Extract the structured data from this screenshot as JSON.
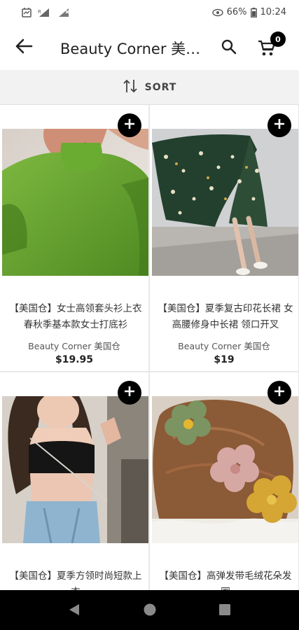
{
  "status_bar": {
    "battery": "66%",
    "time": "10:24"
  },
  "app_bar": {
    "title": "Beauty Corner 美国仓",
    "cart_count": "0"
  },
  "sort": {
    "label": "SORT"
  },
  "products": [
    {
      "name": "【美国仓】女士高领套头衫上衣 春秋季基本款女士打底衫",
      "vendor": "Beauty Corner 美国仓",
      "price": "$19.95"
    },
    {
      "name": "【美国仓】夏季复古印花长裙 女高腰修身中长裙 领口开叉",
      "vendor": "Beauty Corner 美国仓",
      "price": "$19"
    },
    {
      "name": "【美国仓】夏季方领时尚短款上衣",
      "vendor": "",
      "price": ""
    },
    {
      "name": "【美国仓】高弹发带毛绒花朵发圈",
      "vendor": "",
      "price": ""
    }
  ],
  "colors": {
    "sort_bar_bg": "#f2f2f2",
    "badge_bg": "#000000",
    "nav_bar_bg": "#000000"
  },
  "icons": {
    "back": "arrow-left-icon",
    "search": "search-icon",
    "cart": "shopping-cart-icon",
    "sort": "sort-arrows-icon",
    "add": "plus-icon"
  }
}
